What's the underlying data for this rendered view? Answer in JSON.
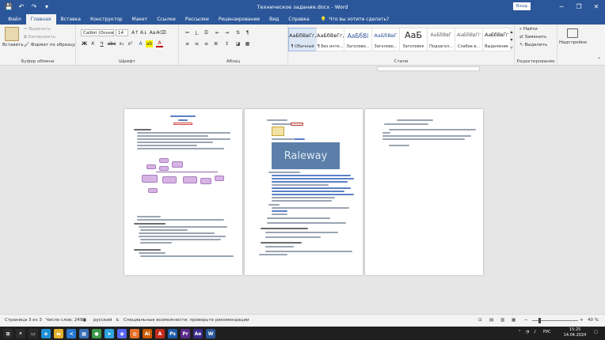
{
  "window": {
    "title": "Техническое задание.docx  -  Word",
    "login_label": "Вход",
    "minimize_icon": "─",
    "restore_icon": "❐",
    "close_icon": "✕"
  },
  "quick_access": {
    "save_icon": "💾",
    "undo_icon": "↶",
    "redo_icon": "↷",
    "customize_icon": "▾"
  },
  "tabs": [
    "Файл",
    "Главная",
    "Вставка",
    "Конструктор",
    "Макет",
    "Ссылки",
    "Рассылки",
    "Рецензирование",
    "Вид",
    "Справка"
  ],
  "active_tab_index": 1,
  "tell_me": "Что вы хотите сделать?",
  "ribbon": {
    "clipboard": {
      "label": "Буфер обмена",
      "paste": "Вставить",
      "cut": "Вырезать",
      "copy": "Копировать",
      "format_painter": "Формат по образцу"
    },
    "font": {
      "label": "Шрифт",
      "font_name": "Calibri (Основ",
      "font_size": "14",
      "bold": "Ж",
      "italic": "К",
      "underline": "Ч",
      "strike": "abc",
      "sub": "x₂",
      "sup": "x²",
      "grow": "A↑",
      "shrink": "A↓",
      "case": "Aa",
      "clear": "A⌫",
      "effects": "A",
      "highlight": "ab",
      "color": "A"
    },
    "paragraph": {
      "label": "Абзац"
    },
    "styles": {
      "label": "Стили",
      "items": [
        {
          "sample": "АаБбВвГг,",
          "name": "¶ Обычный"
        },
        {
          "sample": "АаБбВвГг,",
          "name": "¶ Без инте..."
        },
        {
          "sample": "АаБбВі",
          "name": "Заголово..."
        },
        {
          "sample": "АаБбВвГ",
          "name": "Заголово..."
        },
        {
          "sample": "АаБ",
          "name": "Заголовок"
        },
        {
          "sample": "АаБбВвГ",
          "name": "Подзагол..."
        },
        {
          "sample": "АаБбВвГг",
          "name": "Слабое в..."
        },
        {
          "sample": "АаБбВвГг",
          "name": "Выделение"
        }
      ]
    },
    "editing": {
      "label": "Редактирование",
      "find": "Найти",
      "replace": "Заменить",
      "select": "Выделить"
    },
    "addins": {
      "label": "Надстройки"
    }
  },
  "status": {
    "page": "Страница 3 из 3",
    "words": "Число слов: 249",
    "language": "русский",
    "accessibility": "Специальные возможности: проверьте рекомендации",
    "zoom": "40 %",
    "zoom_minus": "−",
    "zoom_plus": "+"
  },
  "taskbar": {
    "time": "15:25",
    "date": "14.04.2024",
    "lang": "РУС",
    "apps": [
      {
        "name": "start",
        "glyph": "⊞",
        "color": "#2b2b2b"
      },
      {
        "name": "search",
        "glyph": "⌕",
        "color": "#2b2b2b"
      },
      {
        "name": "task-view",
        "glyph": "▭",
        "color": "#2b2b2b"
      },
      {
        "name": "edge",
        "glyph": "e",
        "color": "#1f8fd6"
      },
      {
        "name": "explorer",
        "glyph": "▬",
        "color": "#e6b12e"
      },
      {
        "name": "vscode",
        "glyph": "≺",
        "color": "#2a7ad0"
      },
      {
        "name": "app-grid",
        "glyph": "▦",
        "color": "#3a6fb6"
      },
      {
        "name": "chrome",
        "glyph": "●",
        "color": "#3d9a4a"
      },
      {
        "name": "telegram",
        "glyph": "➤",
        "color": "#2fa3e0"
      },
      {
        "name": "discord",
        "glyph": "◉",
        "color": "#5865f2"
      },
      {
        "name": "firefox",
        "glyph": "◍",
        "color": "#e5702a"
      },
      {
        "name": "illustrator",
        "glyph": "Ai",
        "color": "#cc5a00"
      },
      {
        "name": "acrobat",
        "glyph": "A",
        "color": "#c42b1c"
      },
      {
        "name": "photoshop",
        "glyph": "Ps",
        "color": "#1d5aa6"
      },
      {
        "name": "premiere",
        "glyph": "Pr",
        "color": "#5b2b8a"
      },
      {
        "name": "aftereffects",
        "glyph": "Ae",
        "color": "#3a2a8a"
      },
      {
        "name": "word",
        "glyph": "W",
        "color": "#2b579a"
      }
    ]
  },
  "colors": {
    "brand": "#2b579a",
    "diagram": "#d7b4e4",
    "raleway_bg": "#5b7fa8"
  },
  "document": {
    "raleway_label": "Raleway"
  }
}
